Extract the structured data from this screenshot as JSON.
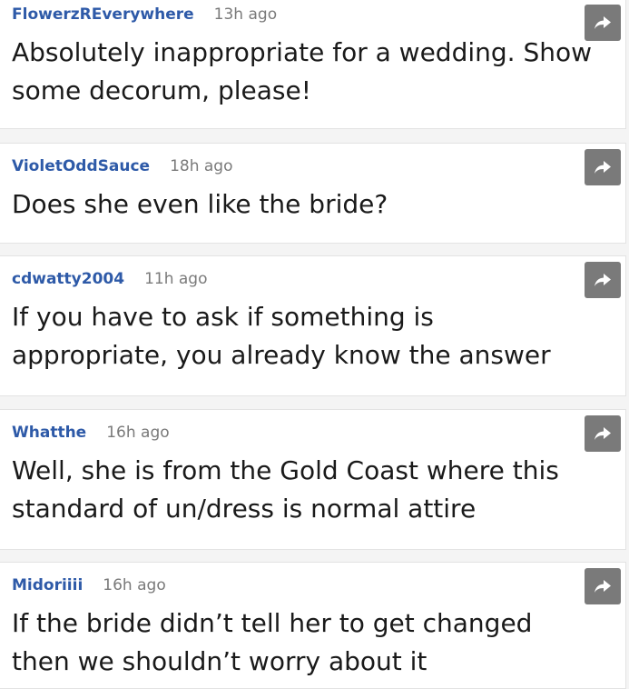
{
  "comments": [
    {
      "author": "FlowerzREverywhere",
      "time": "13h ago",
      "text": "Absolutely inappropriate for a wedding. Show some decorum, please!",
      "share_icon": "share-arrow-icon"
    },
    {
      "author": "VioletOddSauce",
      "time": "18h ago",
      "text": "Does she even like the bride?",
      "share_icon": "share-arrow-icon"
    },
    {
      "author": "cdwatty2004",
      "time": "11h ago",
      "text": "If you have to ask if something is appropriate, you already know the answer",
      "share_icon": "share-arrow-icon"
    },
    {
      "author": "Whatthe",
      "time": "16h ago",
      "text": "Well, she is from the Gold Coast where this standard of un/dress is normal attire",
      "share_icon": "share-arrow-icon"
    },
    {
      "author": "Midoriiii",
      "time": "16h ago",
      "text": "If the bride didn’t tell her to get changed then we shouldn’t worry about it",
      "share_icon": "share-arrow-icon"
    }
  ],
  "colors": {
    "author": "#2e5aa8",
    "timestamp": "#7a7a7a",
    "share_button": "#7a7a7a",
    "background": "#f4f4f4"
  }
}
